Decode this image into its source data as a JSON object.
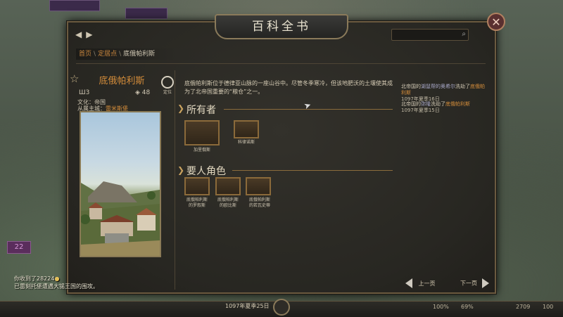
{
  "window": {
    "title": "百科全书",
    "close_glyph": "✕"
  },
  "navigation": {
    "back_glyph": "◀",
    "forward_glyph": "▶"
  },
  "search": {
    "placeholder": "",
    "icon": "search-icon"
  },
  "breadcrumb": {
    "items": [
      "首页",
      "定居点",
      "底俄帕利斯"
    ],
    "separator": "\\"
  },
  "settlement": {
    "name": "底俄帕利斯",
    "locate_label": "定位",
    "stat_left": "3",
    "stat_right": "48",
    "culture_label": "文化：",
    "culture_value": "帝国",
    "bound_to_label": "从属主城：",
    "bound_to_value": "雷米斯堡"
  },
  "description": "底俄帕利斯位于德律亚山脉的一座山谷中。尽管冬季寒冷，但该地肥沃的土壤使其成为了北帝国重要的“粮仓”之一。",
  "owners": {
    "title": "所有者",
    "items": [
      {
        "label": "加里俄斯"
      },
      {
        "label": "科律诺斯"
      }
    ]
  },
  "notables": {
    "title": "要人角色",
    "items": [
      {
        "label_line1": "底俄帕利斯",
        "label_line2": "的罗叙斯"
      },
      {
        "label_line1": "底俄帕利斯",
        "label_line2": "的欧比斯"
      },
      {
        "label_line1": "底俄帕利斯",
        "label_line2": "的若瓦史蒂"
      }
    ]
  },
  "news": [
    {
      "prefix": "北帝国的",
      "actor": "湖鼠帮的奥希尔",
      "verb": "洗劫了",
      "target": "底俄帕利斯",
      "date": "1097年夏季16日"
    },
    {
      "prefix": "北帝国的",
      "actor": "弥隆",
      "verb": "洗劫了",
      "target": "底俄帕利斯",
      "date": "1097年夏季15日"
    }
  ],
  "pagination": {
    "prev": "上一页",
    "next": "下一页"
  },
  "log": {
    "line1": "你收到了28224",
    "line2": "已雷刻托堡遭遇大锡王国的围攻。"
  },
  "hud": {
    "date": "1097年夏季25日",
    "values": [
      "100%",
      "69%",
      "2709",
      "100"
    ]
  },
  "map": {
    "badge": "22"
  },
  "colors": {
    "accent": "#d38c3a",
    "frame": "#8b6a3a",
    "close": "#b08060"
  }
}
